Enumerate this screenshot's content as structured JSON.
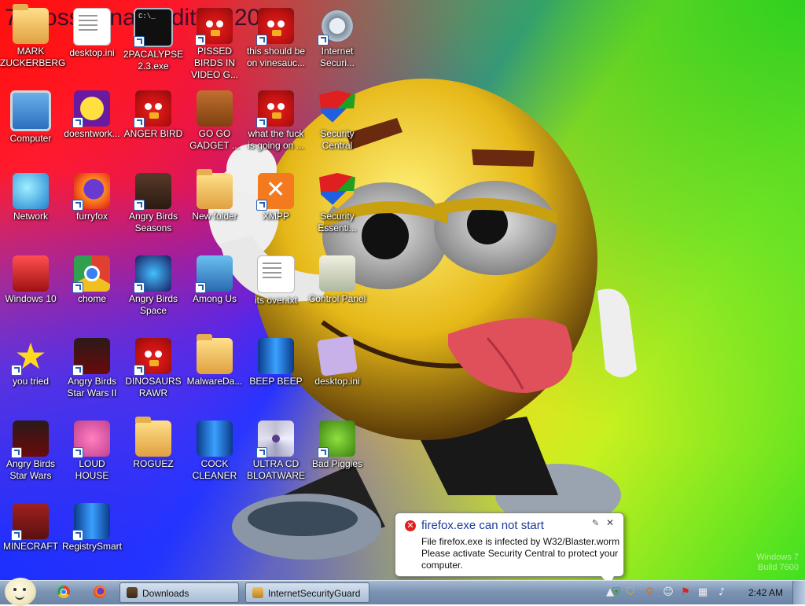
{
  "wallpaper": {
    "overlay_text": "7 MossKanae Edition 2012",
    "brand_line1": "Windows 7",
    "brand_line2": "Build 7600"
  },
  "desktop_icons": [
    {
      "name": "icon-mark-zuckerberg",
      "label": "MARK ZUCKERBERG",
      "art": "folder",
      "shortcut": false
    },
    {
      "name": "icon-desktop-ini-1",
      "label": "desktop.ini",
      "art": "textfile",
      "shortcut": false
    },
    {
      "name": "icon-2pacalypse",
      "label": "2PACALYPSE 2.3.exe",
      "art": "cmd",
      "shortcut": true
    },
    {
      "name": "icon-pissed-birds",
      "label": "PISSED BIRDS IN VIDEO G...",
      "art": "bird",
      "shortcut": true
    },
    {
      "name": "icon-this-should-be",
      "label": "this should be on vinesauc...",
      "art": "bird",
      "shortcut": true
    },
    {
      "name": "icon-internet-security",
      "label": "Internet Securi...",
      "art": "gear",
      "shortcut": true
    },
    {
      "name": "icon-computer",
      "label": "Computer",
      "art": "computer",
      "shortcut": false
    },
    {
      "name": "icon-doesntwork",
      "label": "doesntwork...",
      "art": "yahoo",
      "shortcut": true
    },
    {
      "name": "icon-anger-bird",
      "label": "ANGER BIRD",
      "art": "bird",
      "shortcut": true
    },
    {
      "name": "icon-go-go-gadget",
      "label": "GO GO GADGET ...",
      "art": "briefcase",
      "shortcut": false
    },
    {
      "name": "icon-what-the-fuck",
      "label": "what the fuck is going on ...",
      "art": "bird",
      "shortcut": true
    },
    {
      "name": "icon-security-central",
      "label": "Security Central",
      "art": "shield",
      "shortcut": true
    },
    {
      "name": "icon-network",
      "label": "Network",
      "art": "globe",
      "shortcut": false
    },
    {
      "name": "icon-furryfox",
      "label": "furryfox",
      "art": "firefox",
      "shortcut": true
    },
    {
      "name": "icon-angry-birds-seasons",
      "label": "Angry Birds Seasons",
      "art": "seasons",
      "shortcut": true
    },
    {
      "name": "icon-new-folder",
      "label": "New folder",
      "art": "folder",
      "shortcut": false
    },
    {
      "name": "icon-xmpp",
      "label": "XMPP",
      "art": "xampp",
      "shortcut": true
    },
    {
      "name": "icon-security-essentials",
      "label": "Security Essenti...",
      "art": "shield",
      "shortcut": true
    },
    {
      "name": "icon-windows-10",
      "label": "Windows 10",
      "art": "trash",
      "shortcut": false
    },
    {
      "name": "icon-chome",
      "label": "chome",
      "art": "chrome",
      "shortcut": true
    },
    {
      "name": "icon-angry-birds-space",
      "label": "Angry Birds Space",
      "art": "space",
      "shortcut": true
    },
    {
      "name": "icon-among-us",
      "label": "Among Us",
      "art": "amongus",
      "shortcut": true
    },
    {
      "name": "icon-its-over",
      "label": "its over.txt",
      "art": "textfile",
      "shortcut": false
    },
    {
      "name": "icon-control-panel",
      "label": "Control Panel",
      "art": "cpanel",
      "shortcut": false
    },
    {
      "name": "icon-you-tried",
      "label": "you tried",
      "art": "star",
      "shortcut": true
    },
    {
      "name": "icon-angry-birds-star-wars-ii",
      "label": "Angry Birds Star Wars II",
      "art": "starwars",
      "shortcut": true
    },
    {
      "name": "icon-dinosaurs-rawr",
      "label": "DINOSAURS RAWR",
      "art": "bird",
      "shortcut": true
    },
    {
      "name": "icon-malwareda",
      "label": "MalwareDa...",
      "art": "folder",
      "shortcut": false
    },
    {
      "name": "icon-beep-beep",
      "label": "BEEP BEEP",
      "art": "blue-rect",
      "shortcut": false
    },
    {
      "name": "icon-desktop-ini-2",
      "label": "desktop.ini",
      "art": "notes",
      "shortcut": false
    },
    {
      "name": "icon-angry-birds-star-wars",
      "label": "Angry Birds Star Wars",
      "art": "starwars",
      "shortcut": true
    },
    {
      "name": "icon-loud-house",
      "label": "LOUD HOUSE",
      "art": "pinkbird",
      "shortcut": true
    },
    {
      "name": "icon-roguez",
      "label": "ROGUEZ",
      "art": "folder",
      "shortcut": false
    },
    {
      "name": "icon-cock-cleaner",
      "label": "COCK CLEANER",
      "art": "blue-rect",
      "shortcut": false
    },
    {
      "name": "icon-ultra-cd-bloatware",
      "label": "ULTRA CD BLOATWARE",
      "art": "cd",
      "shortcut": true
    },
    {
      "name": "icon-bad-piggies",
      "label": "Bad Piggies",
      "art": "pig",
      "shortcut": true
    },
    {
      "name": "icon-minecraft",
      "label": "MINECRAFT",
      "art": "minecraft",
      "shortcut": true
    },
    {
      "name": "icon-registrysmart",
      "label": "RegistrySmart",
      "art": "blue-rect",
      "shortcut": true
    }
  ],
  "notification": {
    "title": "firefox.exe can not start",
    "line1": "File firefox.exe is infected by W32/Blaster.worm",
    "line2": "Please activate Security Central to protect your",
    "line3": "computer.",
    "close_glyph": "✕",
    "pin_glyph": "✎"
  },
  "taskbar": {
    "buttons": [
      {
        "name": "taskbar-downloads",
        "label": "Downloads"
      },
      {
        "name": "taskbar-internetsecurityguard",
        "label": "InternetSecurityGuard"
      }
    ],
    "tray_icons": [
      "shield-icon",
      "security-alert-icon",
      "search-icon",
      "messenger-icon",
      "action-center-icon",
      "network-icon",
      "volume-icon"
    ],
    "clock": "2:42 AM"
  },
  "colors": {
    "notification_title": "#1a3a9a",
    "error_red": "#e02020"
  }
}
